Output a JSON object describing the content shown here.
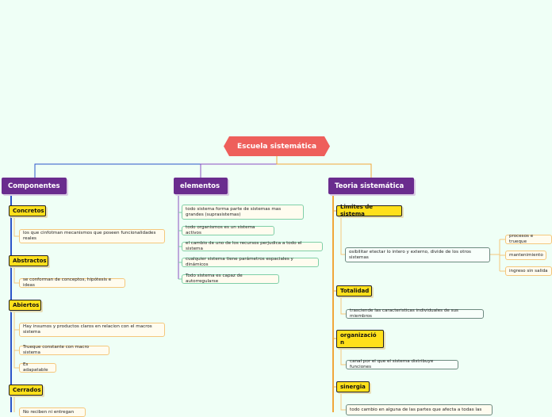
{
  "root": {
    "label": "Escuela sistemática"
  },
  "branches": {
    "componentes": {
      "label": "Componentes",
      "concretos": {
        "label": "Concretos",
        "items": [
          "los que cinfotman mecanismos que poseen funcionalidades reales"
        ]
      },
      "abstractos": {
        "label": "Abstractos",
        "items": [
          "se conforman de conceptos, hipótesis e ideas"
        ]
      },
      "abiertos": {
        "label": "Abiertos",
        "items": [
          "Hay insumos y productos claros en relacion con el macros sistema",
          "Trueque constante con macro sistema",
          "Es adapatable"
        ]
      },
      "cerrados": {
        "label": "Cerrados",
        "items": [
          "No reciben ni entregan"
        ]
      }
    },
    "elementos": {
      "label": "elementos",
      "items": [
        "todo sistema forma parte de sistemas mas grandes (suprasistemas)",
        "todo organismos es un sistema activos",
        "el cambio de uno de los recursos perjudica a todo el sistema",
        "cualquier sistema tiene parámetros espaciales y dinámicos",
        "Todo sistema es capaz de autorregularse"
      ]
    },
    "teoria": {
      "label": "Teoria sistemática",
      "limites": {
        "label": "Limites de sistema",
        "items": [
          "osibilitar etectar lo intero y externo, divide de los otros sistemas"
        ],
        "subitems": [
          "procesos e trueque",
          "mantenimiento",
          "ingreso sin salida"
        ]
      },
      "totalidad": {
        "label": "Totalidad",
        "items": [
          "trasciende las caracteristicas individuales de sus miembros"
        ]
      },
      "organizacion": {
        "label": "organizació n",
        "items": [
          "canal por el que el sistema distribuye funciones"
        ]
      },
      "sinergia": {
        "label": "sinergia",
        "items": [
          "todo cambio en alguna de las partes que afecta a todas las"
        ]
      }
    }
  },
  "colors": {
    "background": "#effff6",
    "root": "#ee5f5b",
    "main_topic": "#6a2c8e",
    "subtopic": "#ffe01b",
    "line_componentes": "#2b55c9",
    "line_elementos": "#8b4fc1",
    "line_teoria": "#f0a73b"
  }
}
